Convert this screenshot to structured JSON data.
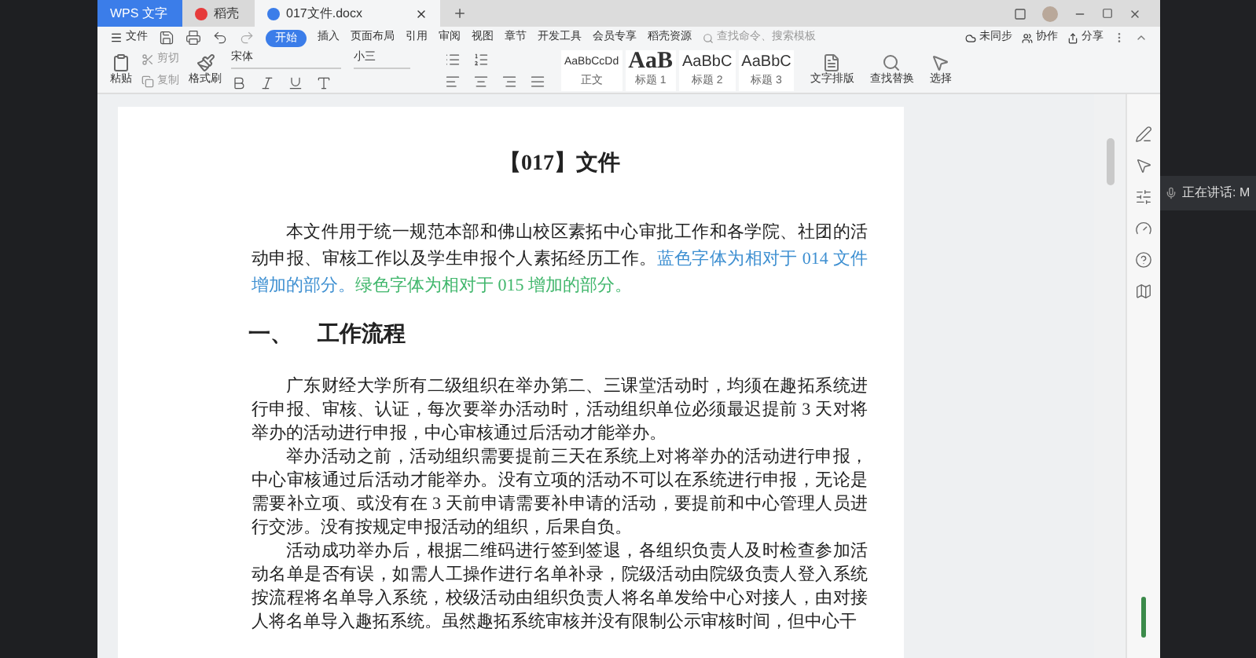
{
  "title_tabs": [
    {
      "label": "WPS 文字",
      "kind": "home",
      "selected": false
    },
    {
      "label": "稻壳",
      "kind": "docer",
      "selected": false
    },
    {
      "label": "017文件.docx",
      "kind": "doc",
      "selected": true
    }
  ],
  "menu": {
    "file": "文件",
    "tabs": [
      {
        "label": "开始",
        "selected": true
      },
      {
        "label": "插入",
        "selected": false
      },
      {
        "label": "页面布局",
        "selected": false
      },
      {
        "label": "引用",
        "selected": false
      },
      {
        "label": "审阅",
        "selected": false
      },
      {
        "label": "视图",
        "selected": false
      },
      {
        "label": "章节",
        "selected": false
      },
      {
        "label": "开发工具",
        "selected": false
      },
      {
        "label": "会员专享",
        "selected": false
      },
      {
        "label": "稻壳资源",
        "selected": false
      }
    ],
    "search": {
      "placeholder": "查找命令、搜索模板"
    },
    "actions": [
      "未同步",
      "协作",
      "分享"
    ]
  },
  "ribbon": {
    "paste": "粘贴",
    "cut": "剪切",
    "copy": "复制",
    "format_painter": "格式刷",
    "font": "宋体",
    "size": "小三",
    "styles": [
      {
        "sample": "AaBbCcDd",
        "name": "正文",
        "kind": "body"
      },
      {
        "sample": "AaB",
        "name": "标题 1",
        "kind": "h1"
      },
      {
        "sample": "AaBbC",
        "name": "标题 2",
        "kind": "h2"
      },
      {
        "sample": "AaBbC",
        "name": "标题 3",
        "kind": "h3"
      }
    ],
    "tools": [
      "文字排版",
      "查找替换",
      "选择"
    ]
  },
  "document": {
    "title": "【017】文件",
    "intro": {
      "text": "本文件用于统一规范本部和佛山校区素拓中心审批工作和各学院、社团的活动申报、审核工作以及学生申报个人素拓经历工作。",
      "blue_note": "蓝色字体为相对于 014 文件增加的部分。",
      "green_note": "绿色字体为相对于 015 增加的部分。"
    },
    "heading": {
      "number": "一、",
      "text": "工作流程"
    },
    "paragraphs": [
      "广东财经大学所有二级组织在举办第二、三课堂活动时，均须在趣拓系统进行申报、审核、认证，每次要举办活动时，活动组织单位必须最迟提前 3 天对将举办的活动进行申报，中心审核通过后活动才能举办。",
      "举办活动之前，活动组织需要提前三天在系统上对将举办的活动进行申报，中心审核通过后活动才能举办。没有立项的活动不可以在系统进行申报，无论是需要补立项、或没有在 3 天前申请需要补申请的活动，要提前和中心管理人员进行交涉。没有按规定申报活动的组织，后果自负。",
      "活动成功举办后，根据二维码进行签到签退，各组织负责人及时检查参加活动名单是否有误，如需人工操作进行名单补录，院级活动由院级负责人登入系统按流程将名单导入系统，校级活动由组织负责人将名单发给中心对接人，由对接人将名单导入趣拓系统。虽然趣拓系统审核并没有限制公示审核时间，但中心干"
    ]
  },
  "speaking": "正在讲话: M"
}
